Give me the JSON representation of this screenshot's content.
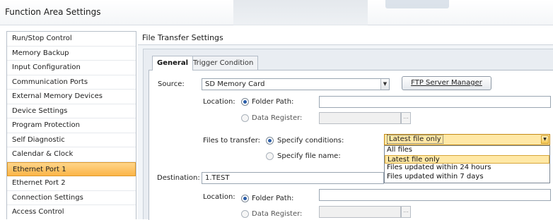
{
  "window": {
    "title": "Function Area Settings"
  },
  "sidebar": {
    "items": [
      {
        "label": "Run/Stop Control"
      },
      {
        "label": "Memory Backup"
      },
      {
        "label": "Input Configuration"
      },
      {
        "label": "Communication Ports"
      },
      {
        "label": "External Memory Devices"
      },
      {
        "label": "Device Settings"
      },
      {
        "label": "Program Protection"
      },
      {
        "label": "Self Diagnostic"
      },
      {
        "label": "Calendar & Clock"
      },
      {
        "label": "Ethernet Port 1",
        "selected": true
      },
      {
        "label": "Ethernet Port 2"
      },
      {
        "label": "Connection Settings"
      },
      {
        "label": "Access Control"
      }
    ]
  },
  "panel": {
    "header": "File Transfer Settings",
    "tabs": [
      {
        "label": "General",
        "active": true
      },
      {
        "label": "Trigger Condition"
      }
    ],
    "source": {
      "label": "Source:",
      "value": "SD Memory Card",
      "ftp_button": "FTP Server Manager",
      "location_label": "Location:",
      "folder_path_label": "Folder Path:",
      "folder_path_value": "",
      "data_register_label": "Data Register:",
      "selected_location": "folder_path"
    },
    "files_to_transfer": {
      "label": "Files to transfer:",
      "specify_conditions_label": "Specify conditions:",
      "specify_name_label": "Specify file name:",
      "selected_mode": "specify_conditions",
      "selected_value": "Latest file only",
      "options": [
        "All files",
        "Latest file only",
        "Files updated within 24 hours",
        "Files updated within 7 days"
      ]
    },
    "destination": {
      "label": "Destination:",
      "value": "1.TEST",
      "location_label": "Location:",
      "folder_path_label": "Folder Path:",
      "data_register_label": "Data Register:",
      "selected_location": "folder_path"
    }
  },
  "colors": {
    "selection": "#fbb548",
    "dropdown_highlight": "#ffe8a6",
    "radio_dot": "#2a5da8"
  }
}
